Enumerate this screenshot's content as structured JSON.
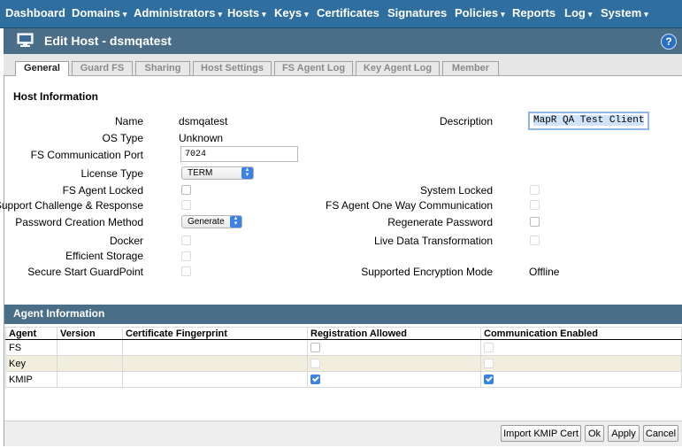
{
  "nav": {
    "items": [
      {
        "label": "Dashboard",
        "caret": ""
      },
      {
        "label": "Domains",
        "caret": "▾"
      },
      {
        "label": "Administrators",
        "caret": "▾"
      },
      {
        "label": "Hosts",
        "caret": "▾"
      },
      {
        "label": "Keys",
        "caret": "▾"
      },
      {
        "label": "Certificates",
        "caret": ""
      },
      {
        "label": "Signatures",
        "caret": ""
      },
      {
        "label": "Policies",
        "caret": "▾"
      },
      {
        "label": "Reports",
        "caret": ""
      },
      {
        "label": "Log",
        "caret": "▾"
      },
      {
        "label": "System",
        "caret": "▾"
      }
    ]
  },
  "page": {
    "title": "Edit Host - dsmqatest",
    "help_label": "?"
  },
  "tabs": [
    {
      "label": "General",
      "active": true
    },
    {
      "label": "Guard FS",
      "active": false
    },
    {
      "label": "Sharing",
      "active": false
    },
    {
      "label": "Host Settings",
      "active": false
    },
    {
      "label": "FS Agent Log",
      "active": false
    },
    {
      "label": "Key Agent Log",
      "active": false
    },
    {
      "label": "Member",
      "active": false
    }
  ],
  "host_info": {
    "section_title": "Host Information",
    "name_label": "Name",
    "name_value": "dsmqatest",
    "os_type_label": "OS Type",
    "os_type_value": "Unknown",
    "fs_port_label": "FS Communication Port",
    "fs_port_value": "7024",
    "license_type_label": "License Type",
    "license_type_value": "TERM",
    "fs_agent_locked_label": "FS Agent Locked",
    "support_cr_label": "Support Challenge & Response",
    "password_method_label": "Password Creation Method",
    "password_method_value": "Generate",
    "docker_label": "Docker",
    "efficient_storage_label": "Efficient Storage",
    "secure_start_label": "Secure Start GuardPoint",
    "description_label": "Description",
    "description_value": "MapR QA Test Client",
    "system_locked_label": "System Locked",
    "fs_one_way_label": "FS Agent One Way Communication",
    "regenerate_password_label": "Regenerate Password",
    "live_data_label": "Live Data Transformation",
    "encryption_mode_label": "Supported Encryption Mode",
    "encryption_mode_value": "Offline"
  },
  "agent_info": {
    "section_title": "Agent Information",
    "columns": [
      "Agent",
      "Version",
      "Certificate Fingerprint",
      "Registration Allowed",
      "Communication Enabled"
    ],
    "rows": [
      {
        "agent": "FS",
        "version": "",
        "fingerprint": "",
        "registration_allowed": false,
        "communication_enabled": false
      },
      {
        "agent": "Key",
        "version": "",
        "fingerprint": "",
        "registration_allowed": false,
        "communication_enabled": false
      },
      {
        "agent": "KMIP",
        "version": "",
        "fingerprint": "",
        "registration_allowed": true,
        "communication_enabled": true
      }
    ]
  },
  "buttons": {
    "import_kmip": "Import KMIP Cert",
    "ok": "Ok",
    "apply": "Apply",
    "cancel": "Cancel"
  },
  "colors": {
    "nav_bg": "#2f6f9f",
    "title_bar_bg": "#4a6d88",
    "checkbox_checked": "#3b82e6",
    "alt_row_bg": "#f1eedd"
  }
}
